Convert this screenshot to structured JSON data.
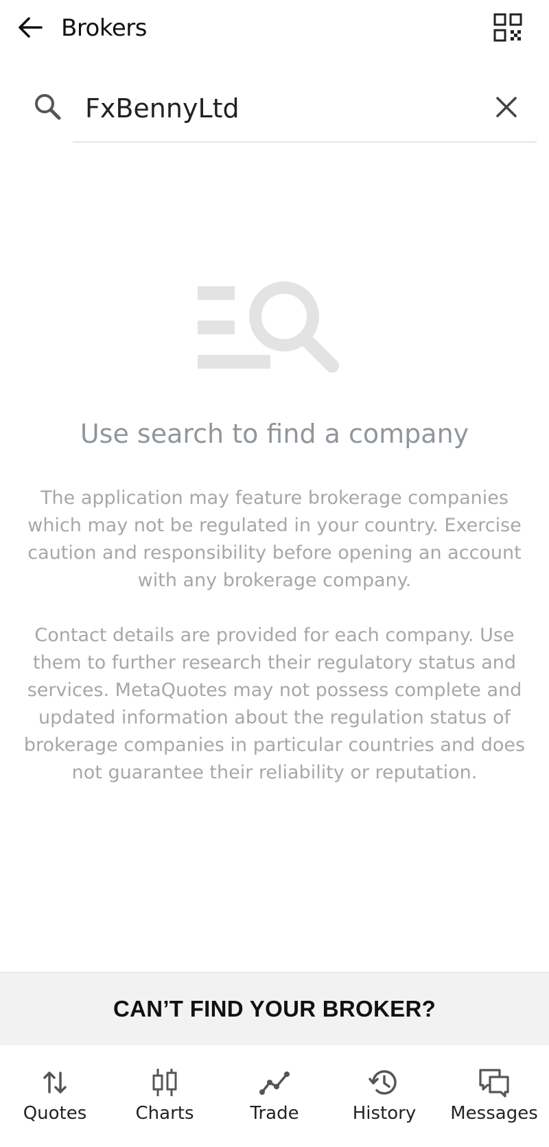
{
  "appbar": {
    "title": "Brokers",
    "back_icon": "arrow-left-icon",
    "qr_icon": "qr-code-icon"
  },
  "search": {
    "value": "FxBennyLtd",
    "placeholder": "",
    "search_icon": "search-icon",
    "clear_icon": "close-icon"
  },
  "empty_state": {
    "illustration": "list-search-icon",
    "headline": "Use search to find a company",
    "notice_1": "The application may feature brokerage companies which may not be regulated in your country. Exercise caution and responsibility before opening an account with any brokerage company.",
    "notice_2": "Contact details are provided for each company. Use them to further research their regulatory status and services. MetaQuotes may not possess complete and updated information about the regulation status of brokerage companies in particular countries and does not guarantee their reliability or reputation."
  },
  "cant_find": {
    "label": "CAN’T FIND YOUR BROKER?"
  },
  "bottom_nav": {
    "items": [
      {
        "label": "Quotes",
        "icon": "arrows-up-down-icon"
      },
      {
        "label": "Charts",
        "icon": "candlestick-icon"
      },
      {
        "label": "Trade",
        "icon": "trend-line-icon"
      },
      {
        "label": "History",
        "icon": "history-icon"
      },
      {
        "label": "Messages",
        "icon": "chat-bubbles-icon"
      }
    ]
  },
  "colors": {
    "headline": "#8f969c",
    "notice_text": "#a7a7a7",
    "illustration": "#e3e3e3",
    "cant_find_bg": "#f2f2f2"
  }
}
